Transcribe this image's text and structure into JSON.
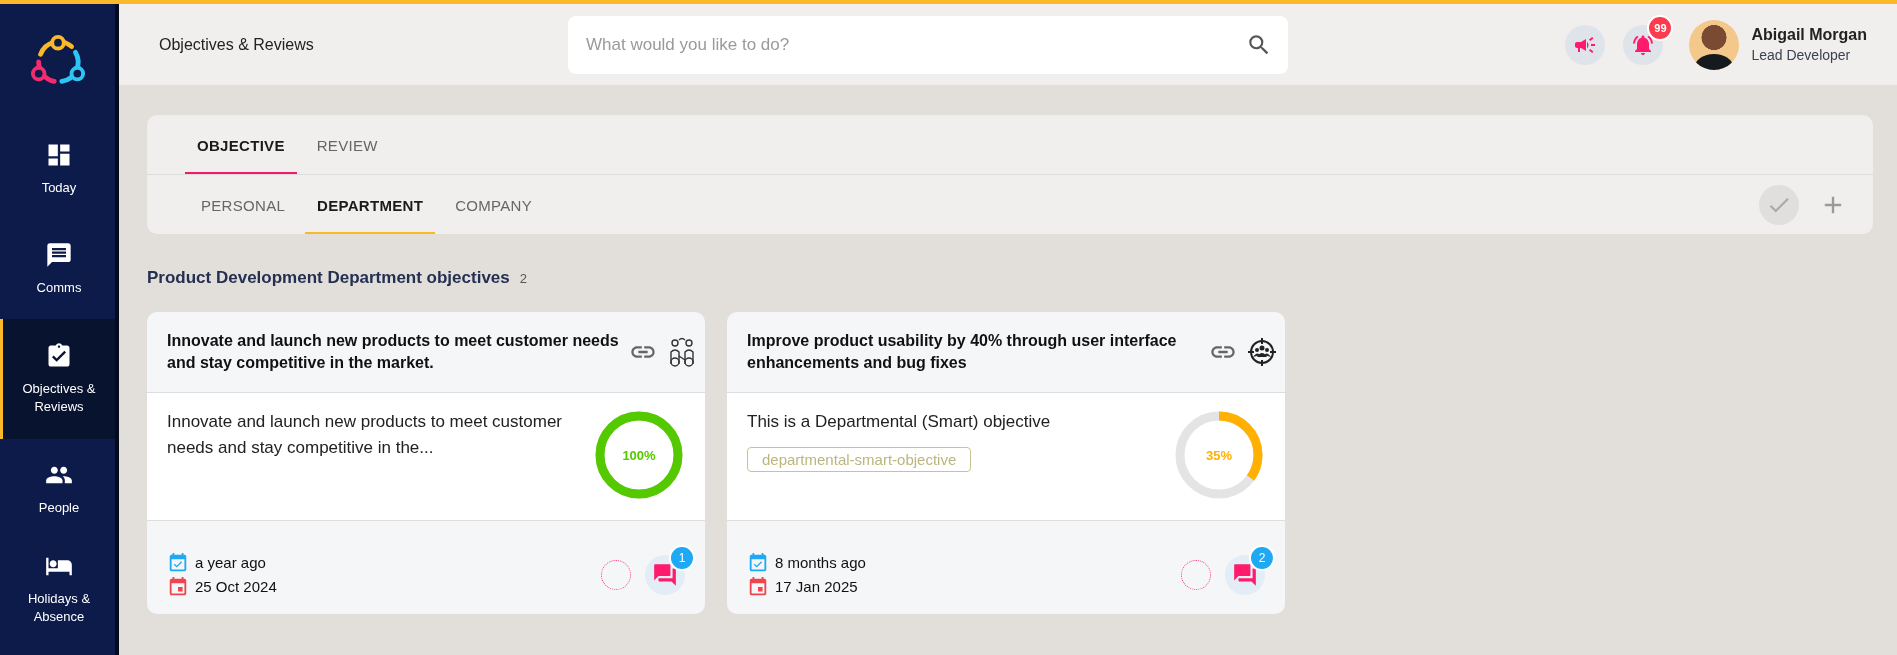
{
  "sidebar": {
    "items": [
      {
        "label": "Today",
        "kind": "dashboard",
        "selected": false
      },
      {
        "label": "Comms",
        "kind": "message",
        "selected": false
      },
      {
        "label": "Objectives & Reviews",
        "kind": "clipboard",
        "selected": true
      },
      {
        "label": "People",
        "kind": "people",
        "selected": false
      },
      {
        "label": "Holidays & Absence",
        "kind": "bed",
        "selected": false
      }
    ]
  },
  "header": {
    "title": "Objectives & Reviews",
    "search": {
      "placeholder": "What would you like to do?"
    },
    "notification_count": "99",
    "user": {
      "name": "Abigail Morgan",
      "role": "Lead Developer"
    }
  },
  "tabs": [
    {
      "label": "OBJECTIVE",
      "selected": true
    },
    {
      "label": "REVIEW",
      "selected": false
    }
  ],
  "subtabs": [
    {
      "label": "PERSONAL",
      "selected": false
    },
    {
      "label": "DEPARTMENT",
      "selected": true
    },
    {
      "label": "COMPANY",
      "selected": false
    }
  ],
  "section": {
    "title": "Product Development Department objectives",
    "count": "2"
  },
  "cards": [
    {
      "title": "Innovate and launch new products to meet customer needs and stay competitive in the market.",
      "kind": "team",
      "description": "Innovate and launch new products to meet customer needs and stay competitive in the...",
      "progress": {
        "level": 1,
        "reading": "100%",
        "color": "#55c900"
      },
      "created": "a year ago",
      "due": "25 Oct 2024",
      "comments": "1"
    },
    {
      "title": "Improve product usability by 40% through user interface enhancements and bug fixes",
      "kind": "target",
      "description": "This is a Departmental (Smart) objective",
      "tag": "departmental-smart-objective",
      "progress": {
        "level": 0.35,
        "reading": "35%",
        "color": "#ffb000"
      },
      "created": "8 months ago",
      "due": "17 Jan 2025",
      "comments": "2"
    }
  ]
}
